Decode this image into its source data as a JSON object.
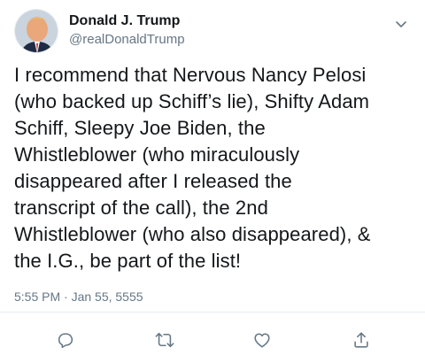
{
  "author": {
    "display_name": "Donald J. Trump",
    "handle": "@realDonaldTrump"
  },
  "tweet": {
    "text": "I recommend that Nervous Nancy Pelosi\n(who backed up Schiff’s lie), Shifty Adam\nSchiff, Sleepy Joe Biden, the\nWhistleblower (who miraculously\ndisappeared after I released the\ntranscript of the call), the 2nd\nWhistleblower (who also disappeared), &\nthe I.G., be part of the list!",
    "timestamp": "5:55 PM · Jan 55, 5555"
  },
  "actions": [
    {
      "name": "reply",
      "icon": "reply-icon"
    },
    {
      "name": "retweet",
      "icon": "retweet-icon"
    },
    {
      "name": "like",
      "icon": "heart-icon"
    },
    {
      "name": "share",
      "icon": "share-icon"
    }
  ],
  "colors": {
    "text": "#14171a",
    "secondary": "#657786",
    "divider": "#e6ecf0"
  }
}
